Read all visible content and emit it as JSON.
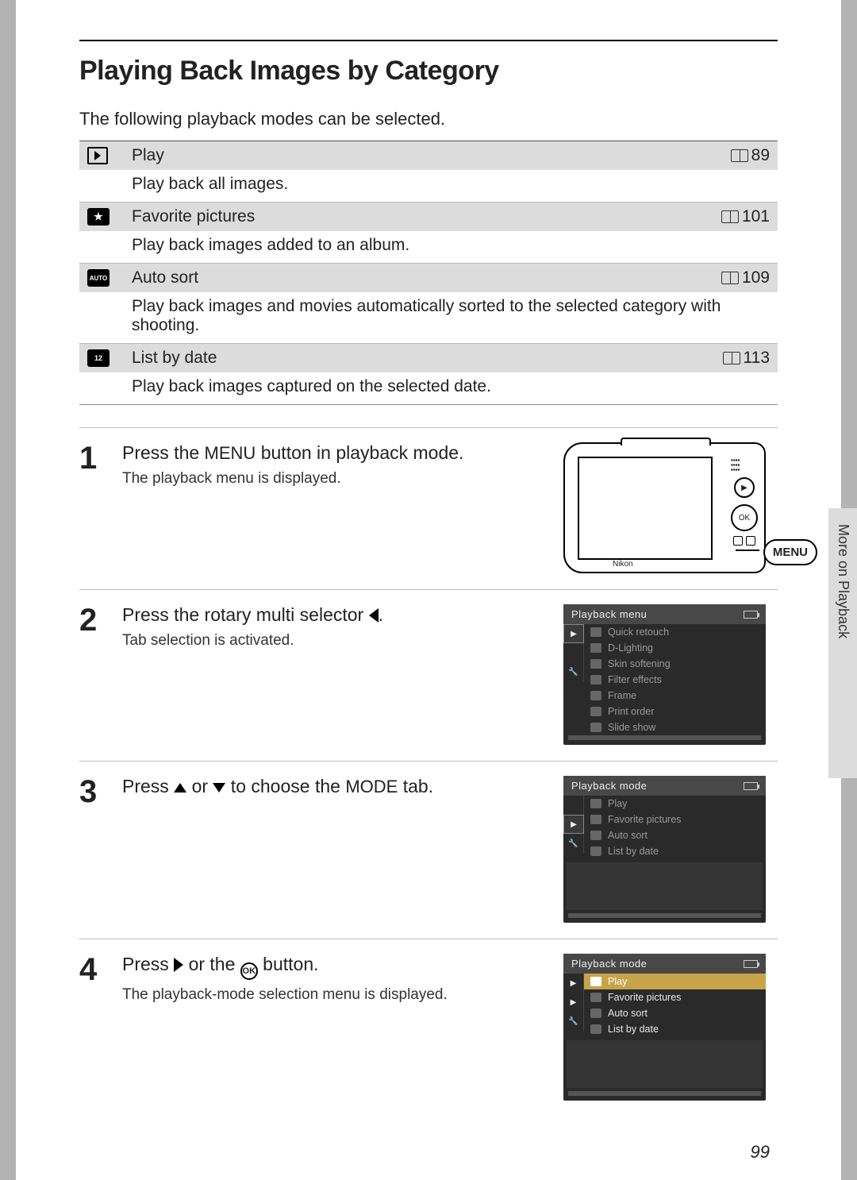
{
  "sideTab": "More on Playback",
  "pageNumber": "99",
  "heading": "Playing Back Images by Category",
  "intro": "The following playback modes can be selected.",
  "modes": [
    {
      "icon": "play",
      "label": "Play",
      "page": "89",
      "desc": "Play back all images."
    },
    {
      "icon": "star",
      "label": "Favorite pictures",
      "page": "101",
      "desc": "Play back images added to an album."
    },
    {
      "icon": "auto",
      "label": "Auto sort",
      "page": "109",
      "desc": "Play back images and movies automatically sorted to the selected category with shooting."
    },
    {
      "icon": "date",
      "label": "List by date",
      "page": "113",
      "desc": "Play back images captured on the selected date."
    }
  ],
  "steps": {
    "s1": {
      "num": "1",
      "title_a": "Press the ",
      "title_menu": "MENU",
      "title_b": " button in playback mode.",
      "sub": "The playback menu is displayed.",
      "cameraBrand": "Nikon",
      "menuBubble": "MENU"
    },
    "s2": {
      "num": "2",
      "title_a": "Press the rotary multi selector ",
      "title_b": ".",
      "sub": "Tab selection is activated.",
      "lcdTitle": "Playback menu",
      "items": [
        "Quick retouch",
        "D-Lighting",
        "Skin softening",
        "Filter effects",
        "Frame",
        "Print order",
        "Slide show"
      ]
    },
    "s3": {
      "num": "3",
      "title_a": "Press ",
      "title_mid": " or ",
      "title_b": " to choose the ",
      "title_mode": "MODE",
      "title_c": " tab.",
      "lcdTitle": "Playback mode",
      "items": [
        "Play",
        "Favorite pictures",
        "Auto sort",
        "List by date"
      ]
    },
    "s4": {
      "num": "4",
      "title_a": "Press ",
      "title_mid": " or the ",
      "title_ok": "OK",
      "title_b": " button.",
      "sub": "The playback-mode selection menu is displayed.",
      "lcdTitle": "Playback mode",
      "items": [
        "Play",
        "Favorite pictures",
        "Auto sort",
        "List by date"
      ]
    }
  }
}
